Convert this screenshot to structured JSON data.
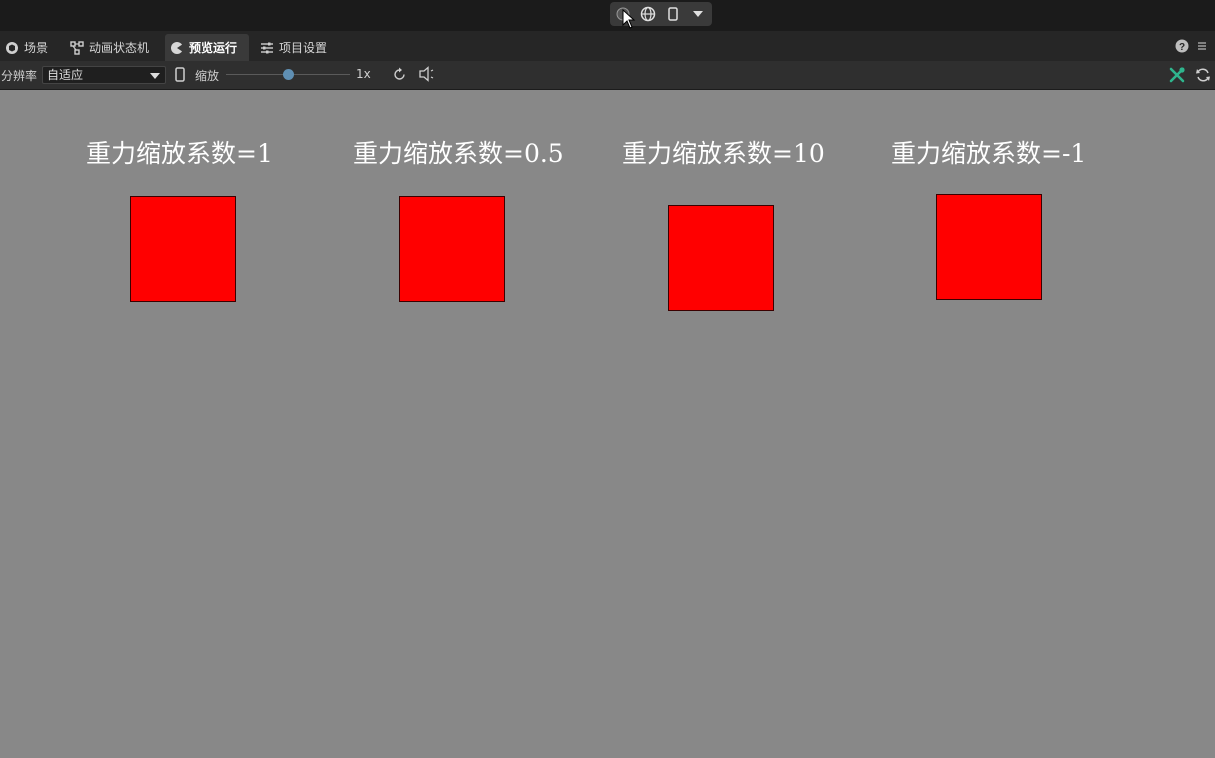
{
  "toolbar": {
    "play_group_icons": [
      "record-icon",
      "globe-icon",
      "phone-icon",
      "dropdown-icon"
    ]
  },
  "tabs": [
    {
      "label": "场景",
      "icon": "scene-icon",
      "active": false
    },
    {
      "label": "动画状态机",
      "icon": "state-machine-icon",
      "active": false
    },
    {
      "label": "预览运行",
      "icon": "preview-icon",
      "active": true
    },
    {
      "label": "项目设置",
      "icon": "settings-icon",
      "active": false
    }
  ],
  "options": {
    "resolution_label": "分辨率",
    "resolution_value": "自适应",
    "zoom_label": "缩放",
    "zoom_value": "1x",
    "zoom_slider_fraction": 0.5
  },
  "colors": {
    "scene_bg": "#888888",
    "box": "#ff0000",
    "accent_green": "#2fb58d",
    "slider_knob": "#5f8fb3"
  },
  "scene": {
    "items": [
      {
        "label": "重力缩放系数=1"
      },
      {
        "label": "重力缩放系数=0.5"
      },
      {
        "label": "重力缩放系数=10"
      },
      {
        "label": "重力缩放系数=-1"
      }
    ]
  }
}
